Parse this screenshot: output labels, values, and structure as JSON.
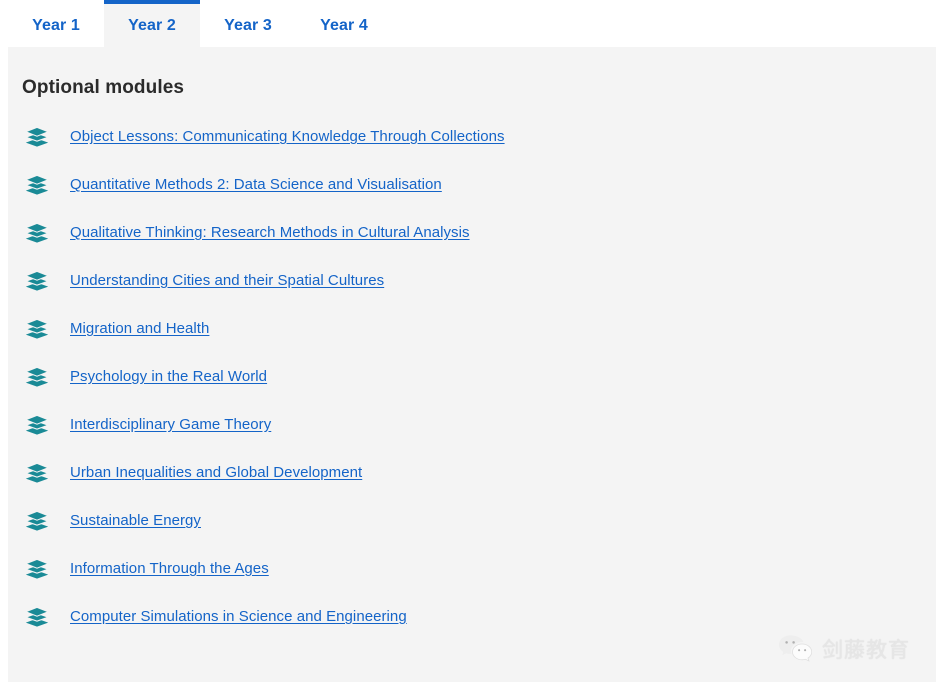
{
  "tabs": {
    "items": [
      {
        "label": "Year 1",
        "active": false
      },
      {
        "label": "Year 2",
        "active": true
      },
      {
        "label": "Year 3",
        "active": false
      },
      {
        "label": "Year 4",
        "active": false
      }
    ]
  },
  "panel": {
    "title": "Optional modules",
    "modules": [
      {
        "label": "Object Lessons: Communicating Knowledge Through Collections",
        "icon": "layers-icon"
      },
      {
        "label": "Quantitative Methods 2: Data Science and Visualisation",
        "icon": "layers-icon"
      },
      {
        "label": "Qualitative Thinking: Research Methods in Cultural Analysis",
        "icon": "layers-icon"
      },
      {
        "label": "Understanding Cities and their Spatial Cultures",
        "icon": "layers-icon"
      },
      {
        "label": "Migration and Health",
        "icon": "layers-icon"
      },
      {
        "label": "Psychology in the Real World",
        "icon": "layers-icon"
      },
      {
        "label": "Interdisciplinary Game Theory",
        "icon": "layers-icon"
      },
      {
        "label": "Urban Inequalities and Global Development",
        "icon": "layers-icon"
      },
      {
        "label": "Sustainable Energy",
        "icon": "layers-icon"
      },
      {
        "label": "Information Through the Ages",
        "icon": "layers-icon"
      },
      {
        "label": "Computer Simulations in Science and Engineering",
        "icon": "layers-icon"
      }
    ]
  },
  "watermark": {
    "icon": "wechat-icon",
    "text": "剑藤教育"
  },
  "colors": {
    "link_blue": "#1464c8",
    "accent_blue": "#1464c8",
    "icon_teal": "#1a8a96",
    "panel_bg": "#f4f4f4",
    "page_bg": "#ffffff",
    "title_text": "#2b2b2b",
    "watermark_text": "#e2e2e2"
  }
}
